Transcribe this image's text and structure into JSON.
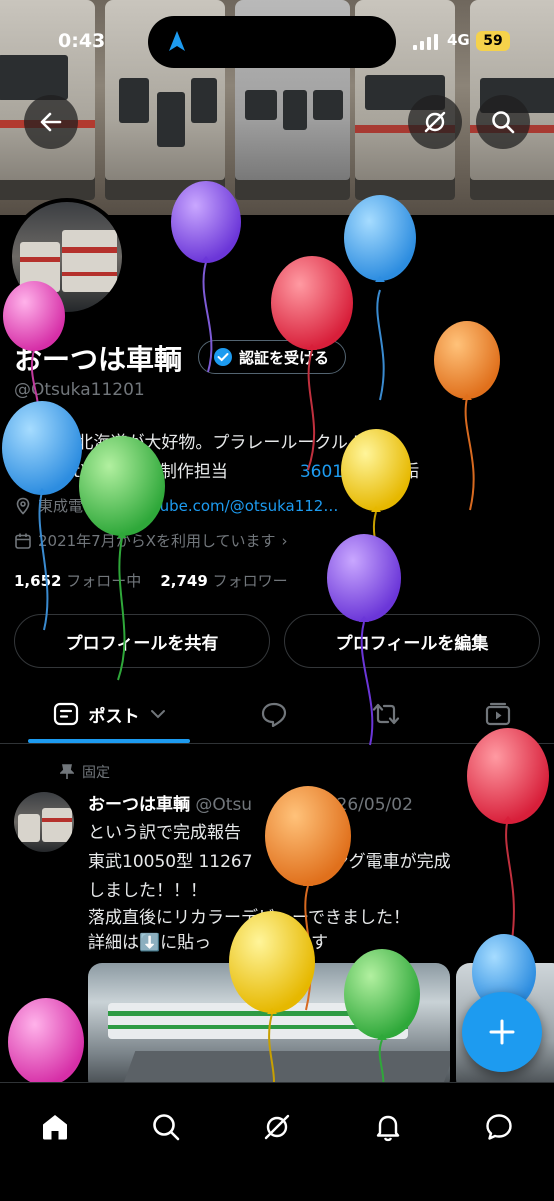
{
  "status_bar": {
    "time": "0:43",
    "network": "4G",
    "battery": "59"
  },
  "profile": {
    "display_name": "おーつは車輌",
    "verify_label": "認証を受ける",
    "handle": "@Otsuka11201",
    "bio_line1_visible": "生 北海道が大好物。プラレール",
    "bio_line1_tail": "ークル PGU",
    "bio_line2_link1": "a",
    "bio_line2_mid": "it) にて車両制作担当",
    "bio_line2_link2": "3601",
    "bio_line2_tail": "← 写真垢",
    "location": "東成電",
    "website": "outube.com/@otsuka112…",
    "joined": "2021年7月からXを利用しています",
    "following_count": "1,652",
    "following_label": "フォロー中",
    "followers_count": "2,749",
    "followers_label": "フォロワー",
    "share_button": "プロフィールを共有",
    "edit_button": "プロフィールを編集"
  },
  "tabs": {
    "posts_label": "ポスト"
  },
  "tweet": {
    "pinned_label": "固定",
    "author": "おーつは車輌",
    "handle": "@Otsu",
    "date": "2026/05/02",
    "lines": [
      "という訳で完成報告",
      "東武10050型 11267",
      "しました！！！",
      "落成直後にリカラーデビューできました！",
      "詳細は⬇️に貼っ"
    ],
    "line2_tail": "ッピング電車が完成",
    "line5_tail": "す"
  },
  "colors": {
    "accent": "#1d9bf0",
    "background": "#000000",
    "muted": "#71767b"
  }
}
